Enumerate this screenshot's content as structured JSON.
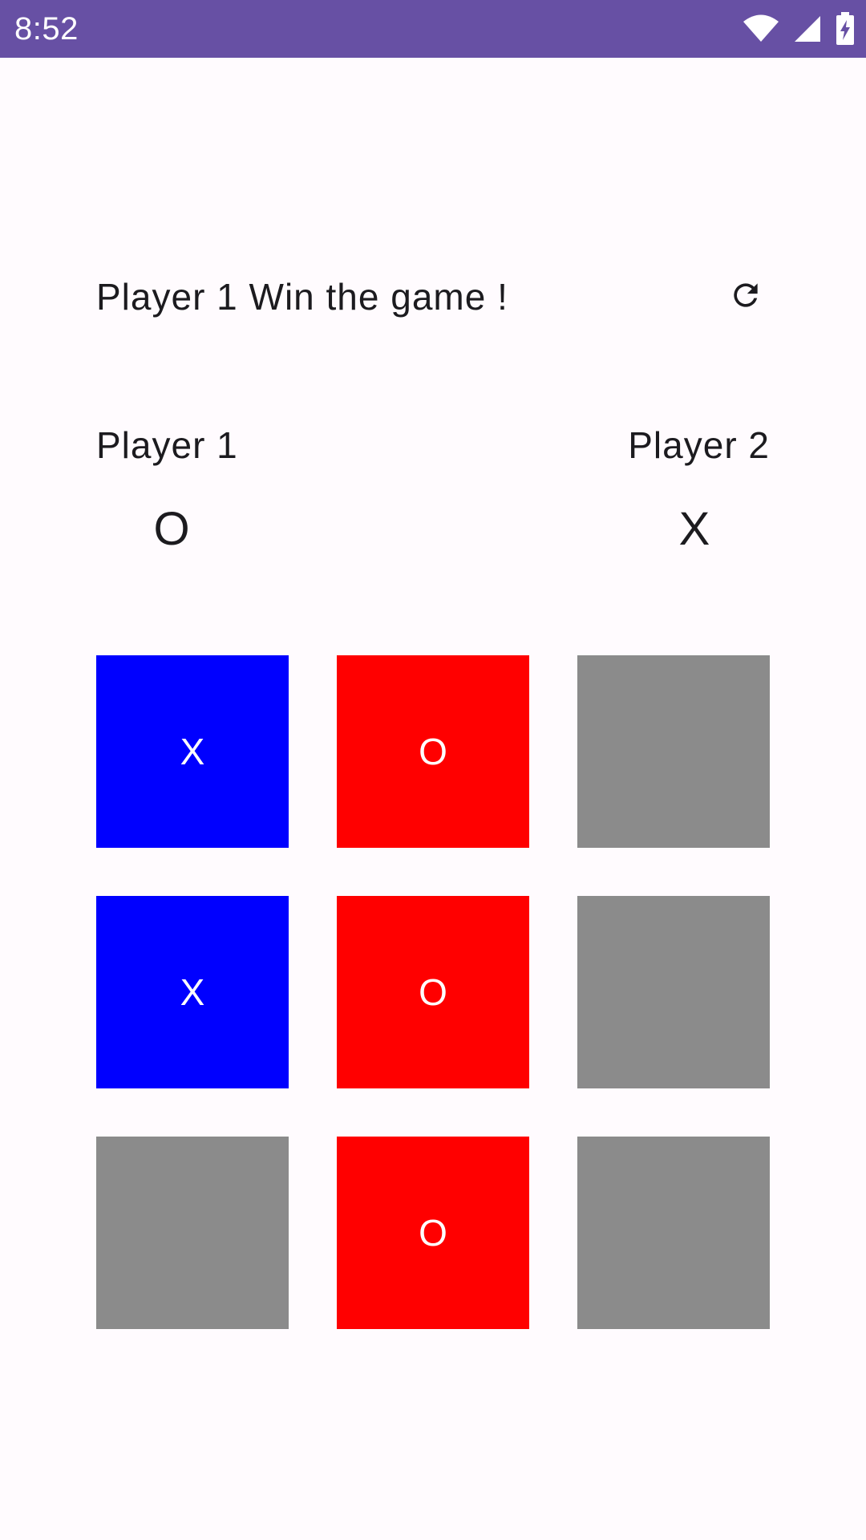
{
  "status_bar": {
    "time": "8:52",
    "icons": [
      "wifi-icon",
      "cell-signal-icon",
      "battery-charging-icon"
    ],
    "background": "#6750a4"
  },
  "game": {
    "message": "Player 1 Win the game !",
    "refresh_icon": "refresh-icon",
    "players": [
      {
        "label": "Player 1",
        "symbol": "O"
      },
      {
        "label": "Player 2",
        "symbol": "X"
      }
    ],
    "board": [
      {
        "value": "X",
        "state": "x"
      },
      {
        "value": "O",
        "state": "o"
      },
      {
        "value": "",
        "state": "empty"
      },
      {
        "value": "X",
        "state": "x"
      },
      {
        "value": "O",
        "state": "o"
      },
      {
        "value": "",
        "state": "empty"
      },
      {
        "value": "",
        "state": "empty"
      },
      {
        "value": "O",
        "state": "o"
      },
      {
        "value": "",
        "state": "empty"
      }
    ],
    "colors": {
      "x_cell": "#0000ff",
      "o_cell": "#ff0000",
      "empty_cell": "#8b8b8b"
    }
  }
}
